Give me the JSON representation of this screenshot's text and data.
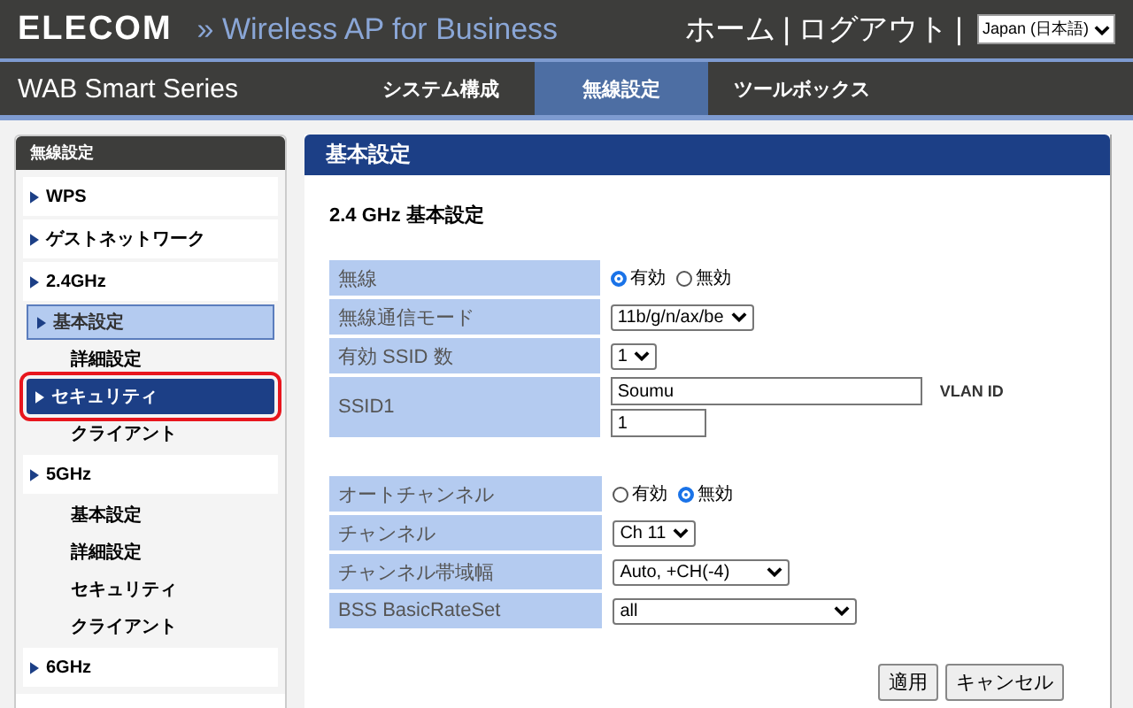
{
  "header": {
    "logo": "ELECOM",
    "product": "» Wireless AP for Business",
    "links": [
      "ホーム",
      "ログアウト"
    ],
    "separator": "|",
    "language": "Japan (日本語)"
  },
  "nav": {
    "series": "WAB Smart Series",
    "tabs": [
      {
        "label": "システム構成",
        "selected": false
      },
      {
        "label": "無線設定",
        "selected": true
      },
      {
        "label": "ツールボックス",
        "selected": false
      }
    ]
  },
  "sidebar": {
    "title": "無線設定",
    "groups": [
      {
        "label": "WPS"
      },
      {
        "label": "ゲストネットワーク"
      },
      {
        "label": "2.4GHz",
        "children": [
          {
            "label": "基本設定",
            "selected": true,
            "hovered": false,
            "circled": false
          },
          {
            "label": "詳細設定",
            "selected": false,
            "hovered": false,
            "circled": false
          },
          {
            "label": "セキュリティ",
            "selected": false,
            "hovered": true,
            "circled": true
          },
          {
            "label": "クライアント",
            "selected": false,
            "hovered": false,
            "circled": false
          }
        ]
      },
      {
        "label": "5GHz",
        "children": [
          {
            "label": "基本設定",
            "selected": false,
            "hovered": false,
            "circled": false
          },
          {
            "label": "詳細設定",
            "selected": false,
            "hovered": false,
            "circled": false
          },
          {
            "label": "セキュリティ",
            "selected": false,
            "hovered": false,
            "circled": false
          },
          {
            "label": "クライアント",
            "selected": false,
            "hovered": false,
            "circled": false
          }
        ]
      },
      {
        "label": "6GHz"
      }
    ]
  },
  "panel": {
    "title": "基本設定",
    "subtitle": "2.4 GHz 基本設定",
    "tables": [
      [
        {
          "label": "無線",
          "kind": "radio",
          "options": [
            {
              "label": "有効",
              "selected": true
            },
            {
              "label": "無効",
              "selected": false
            }
          ]
        },
        {
          "label": "無線通信モード",
          "kind": "select",
          "value": "11b/g/n/ax/be"
        },
        {
          "label": "有効 SSID 数",
          "kind": "select",
          "value": "1"
        },
        {
          "label": "SSID1",
          "kind": "ssid",
          "value": "Soumu",
          "vlan_label": "VLAN ID",
          "vlan_value": "1"
        }
      ],
      [
        {
          "label": "オートチャンネル",
          "kind": "radio",
          "options": [
            {
              "label": "有効",
              "selected": false
            },
            {
              "label": "無効",
              "selected": true
            }
          ]
        },
        {
          "label": "チャンネル",
          "kind": "select",
          "value": "Ch 11"
        },
        {
          "label": "チャンネル帯域幅",
          "kind": "select-medium",
          "value": "Auto, +CH(-4)"
        },
        {
          "label": "BSS BasicRateSet",
          "kind": "select-wide",
          "value": "all"
        }
      ]
    ],
    "buttons": [
      "適用",
      "キャンセル"
    ]
  }
}
